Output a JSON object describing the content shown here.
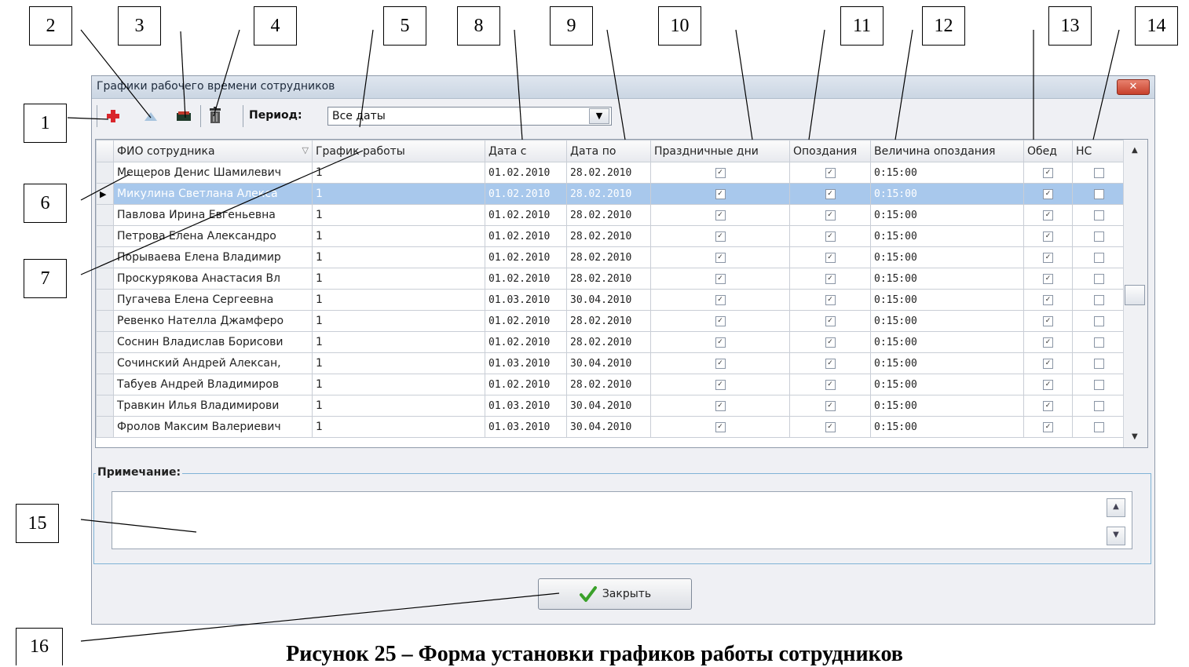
{
  "callouts": [
    "1",
    "2",
    "3",
    "4",
    "5",
    "6",
    "7",
    "8",
    "9",
    "10",
    "11",
    "12",
    "13",
    "14",
    "15",
    "16"
  ],
  "window": {
    "title": "Графики рабочего времени сотрудников",
    "close_glyph": "✕"
  },
  "toolbar": {
    "icons": [
      "add-icon",
      "up-arrow-icon",
      "edit-icon",
      "trash-icon"
    ],
    "period_label": "Период:",
    "period_value": "Все даты",
    "dropdown_glyph": "▼"
  },
  "grid": {
    "columns": [
      "ФИО сотрудника",
      "График работы",
      "Дата с",
      "Дата по",
      "Праздничные дни",
      "Опоздания",
      "Величина опоздания",
      "Обед",
      "НС"
    ],
    "sort_glyph": "▽",
    "rows": [
      {
        "name": "Мещеров Денис Шамилевич",
        "schedule": "1",
        "from": "01.02.2010",
        "to": "28.02.2010",
        "late": "0:15:00"
      },
      {
        "name": "Микулина Светлана Алекса",
        "schedule": "1",
        "from": "01.02.2010",
        "to": "28.02.2010",
        "late": "0:15:00"
      },
      {
        "name": "Павлова Ирина Евгеньевна",
        "schedule": "1",
        "from": "01.02.2010",
        "to": "28.02.2010",
        "late": "0:15:00"
      },
      {
        "name": "Петрова Елена Александро",
        "schedule": "1",
        "from": "01.02.2010",
        "to": "28.02.2010",
        "late": "0:15:00"
      },
      {
        "name": "Порываева Елена Владимир",
        "schedule": "1",
        "from": "01.02.2010",
        "to": "28.02.2010",
        "late": "0:15:00"
      },
      {
        "name": "Проскурякова Анастасия Вл",
        "schedule": "1",
        "from": "01.02.2010",
        "to": "28.02.2010",
        "late": "0:15:00"
      },
      {
        "name": "Пугачева Елена Сергеевна",
        "schedule": "1",
        "from": "01.03.2010",
        "to": "30.04.2010",
        "late": "0:15:00"
      },
      {
        "name": "Ревенко Нателла Джамферо",
        "schedule": "1",
        "from": "01.02.2010",
        "to": "28.02.2010",
        "late": "0:15:00"
      },
      {
        "name": "Соснин Владислав Борисови",
        "schedule": "1",
        "from": "01.02.2010",
        "to": "28.02.2010",
        "late": "0:15:00"
      },
      {
        "name": "Сочинский Андрей Алексан,",
        "schedule": "1",
        "from": "01.03.2010",
        "to": "30.04.2010",
        "late": "0:15:00"
      },
      {
        "name": "Табуев Андрей Владимиров",
        "schedule": "1",
        "from": "01.02.2010",
        "to": "28.02.2010",
        "late": "0:15:00"
      },
      {
        "name": "Травкин Илья Владимирови",
        "schedule": "1",
        "from": "01.03.2010",
        "to": "30.04.2010",
        "late": "0:15:00"
      },
      {
        "name": "Фролов Максим Валериевич",
        "schedule": "1",
        "from": "01.03.2010",
        "to": "30.04.2010",
        "late": "0:15:00"
      }
    ],
    "selected_row": 1,
    "row_indicator_glyph": "▶",
    "check_glyph": "✓",
    "scroll_up_glyph": "▲",
    "scroll_down_glyph": "▼"
  },
  "note": {
    "label": "Примечание:",
    "up_glyph": "▲",
    "down_glyph": "▼"
  },
  "footer": {
    "close_label": "Закрыть",
    "check_icon": "checkmark-icon"
  },
  "caption": "Рисунок 25 – Форма установки графиков работы сотрудников",
  "colors": {
    "selection": "#a8c8ec",
    "add": "#d9262c",
    "check": "#3aa12a"
  }
}
